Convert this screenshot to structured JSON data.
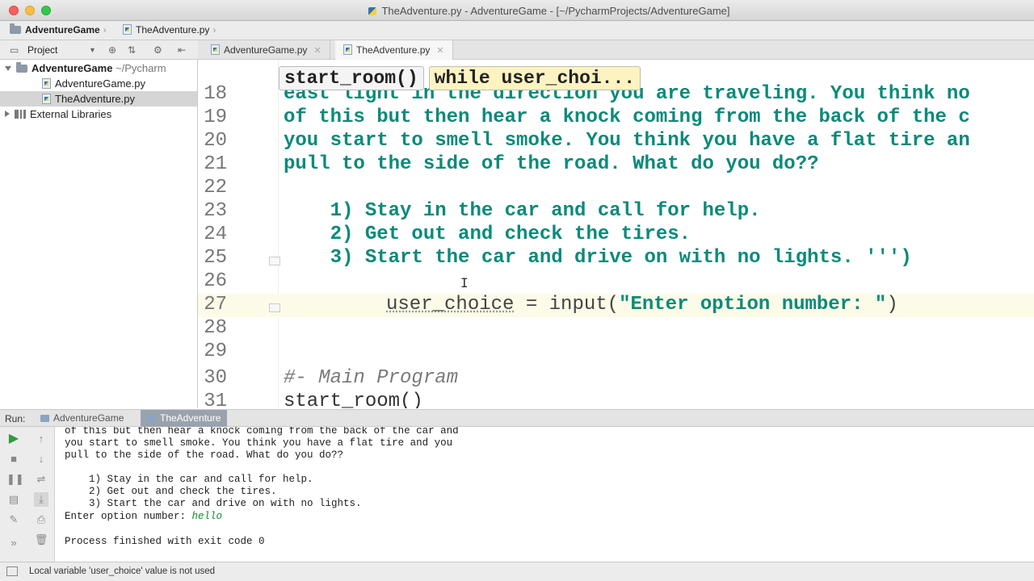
{
  "window": {
    "title": "TheAdventure.py - AdventureGame - [~/PycharmProjects/AdventureGame]"
  },
  "breadcrumb": {
    "project": "AdventureGame",
    "file": "TheAdventure.py"
  },
  "project_panel": {
    "label": "Project",
    "root": "AdventureGame",
    "root_path": "~/Pycharm",
    "files": [
      "AdventureGame.py",
      "TheAdventure.py"
    ],
    "selected_file": "TheAdventure.py",
    "external": "External Libraries"
  },
  "editor_tabs": [
    {
      "label": "AdventureGame.py",
      "active": false
    },
    {
      "label": "TheAdventure.py",
      "active": true
    }
  ],
  "code_breadcrumb": [
    "start_room()",
    "while user_choi..."
  ],
  "code_lines": [
    {
      "num": "18",
      "text": "east light in the direction you are traveling. You think no"
    },
    {
      "num": "19",
      "text": "of this but then hear a knock coming from the back of the c"
    },
    {
      "num": "20",
      "text": "you start to smell smoke. You think you have a flat tire an"
    },
    {
      "num": "21",
      "text": "pull to the side of the road. What do you do??"
    },
    {
      "num": "22",
      "text": ""
    },
    {
      "num": "23",
      "text": "    1) Stay in the car and call for help."
    },
    {
      "num": "24",
      "text": "    2) Get out and check the tires."
    },
    {
      "num": "25",
      "text": "    3) Start the car and drive on with no lights. ''')"
    },
    {
      "num": "26",
      "text": ""
    },
    {
      "num": "27",
      "var": "user_choice",
      "rest": " = input(",
      "str": "\"Enter option number: \"",
      "close": ")"
    },
    {
      "num": "28",
      "text": ""
    },
    {
      "num": "29",
      "text": ""
    },
    {
      "num": "30",
      "comment": "#- Main Program"
    },
    {
      "num": "31",
      "fn": "start_room()"
    }
  ],
  "run_panel": {
    "label": "Run:",
    "tabs": [
      {
        "label": "AdventureGame",
        "active": false
      },
      {
        "label": "TheAdventure",
        "active": true
      }
    ],
    "console": [
      "of this but then hear a knock coming from the back of the car and",
      "you start to smell smoke. You think you have a flat tire and you",
      "pull to the side of the road. What do you do??",
      "",
      "    1) Stay in the car and call for help.",
      "    2) Get out and check the tires.",
      "    3) Start the car and drive on with no lights.",
      "Enter option number: ",
      "",
      "Process finished with exit code 0"
    ],
    "user_input": "hello"
  },
  "status": {
    "message": "Local variable 'user_choice' value is not used"
  }
}
